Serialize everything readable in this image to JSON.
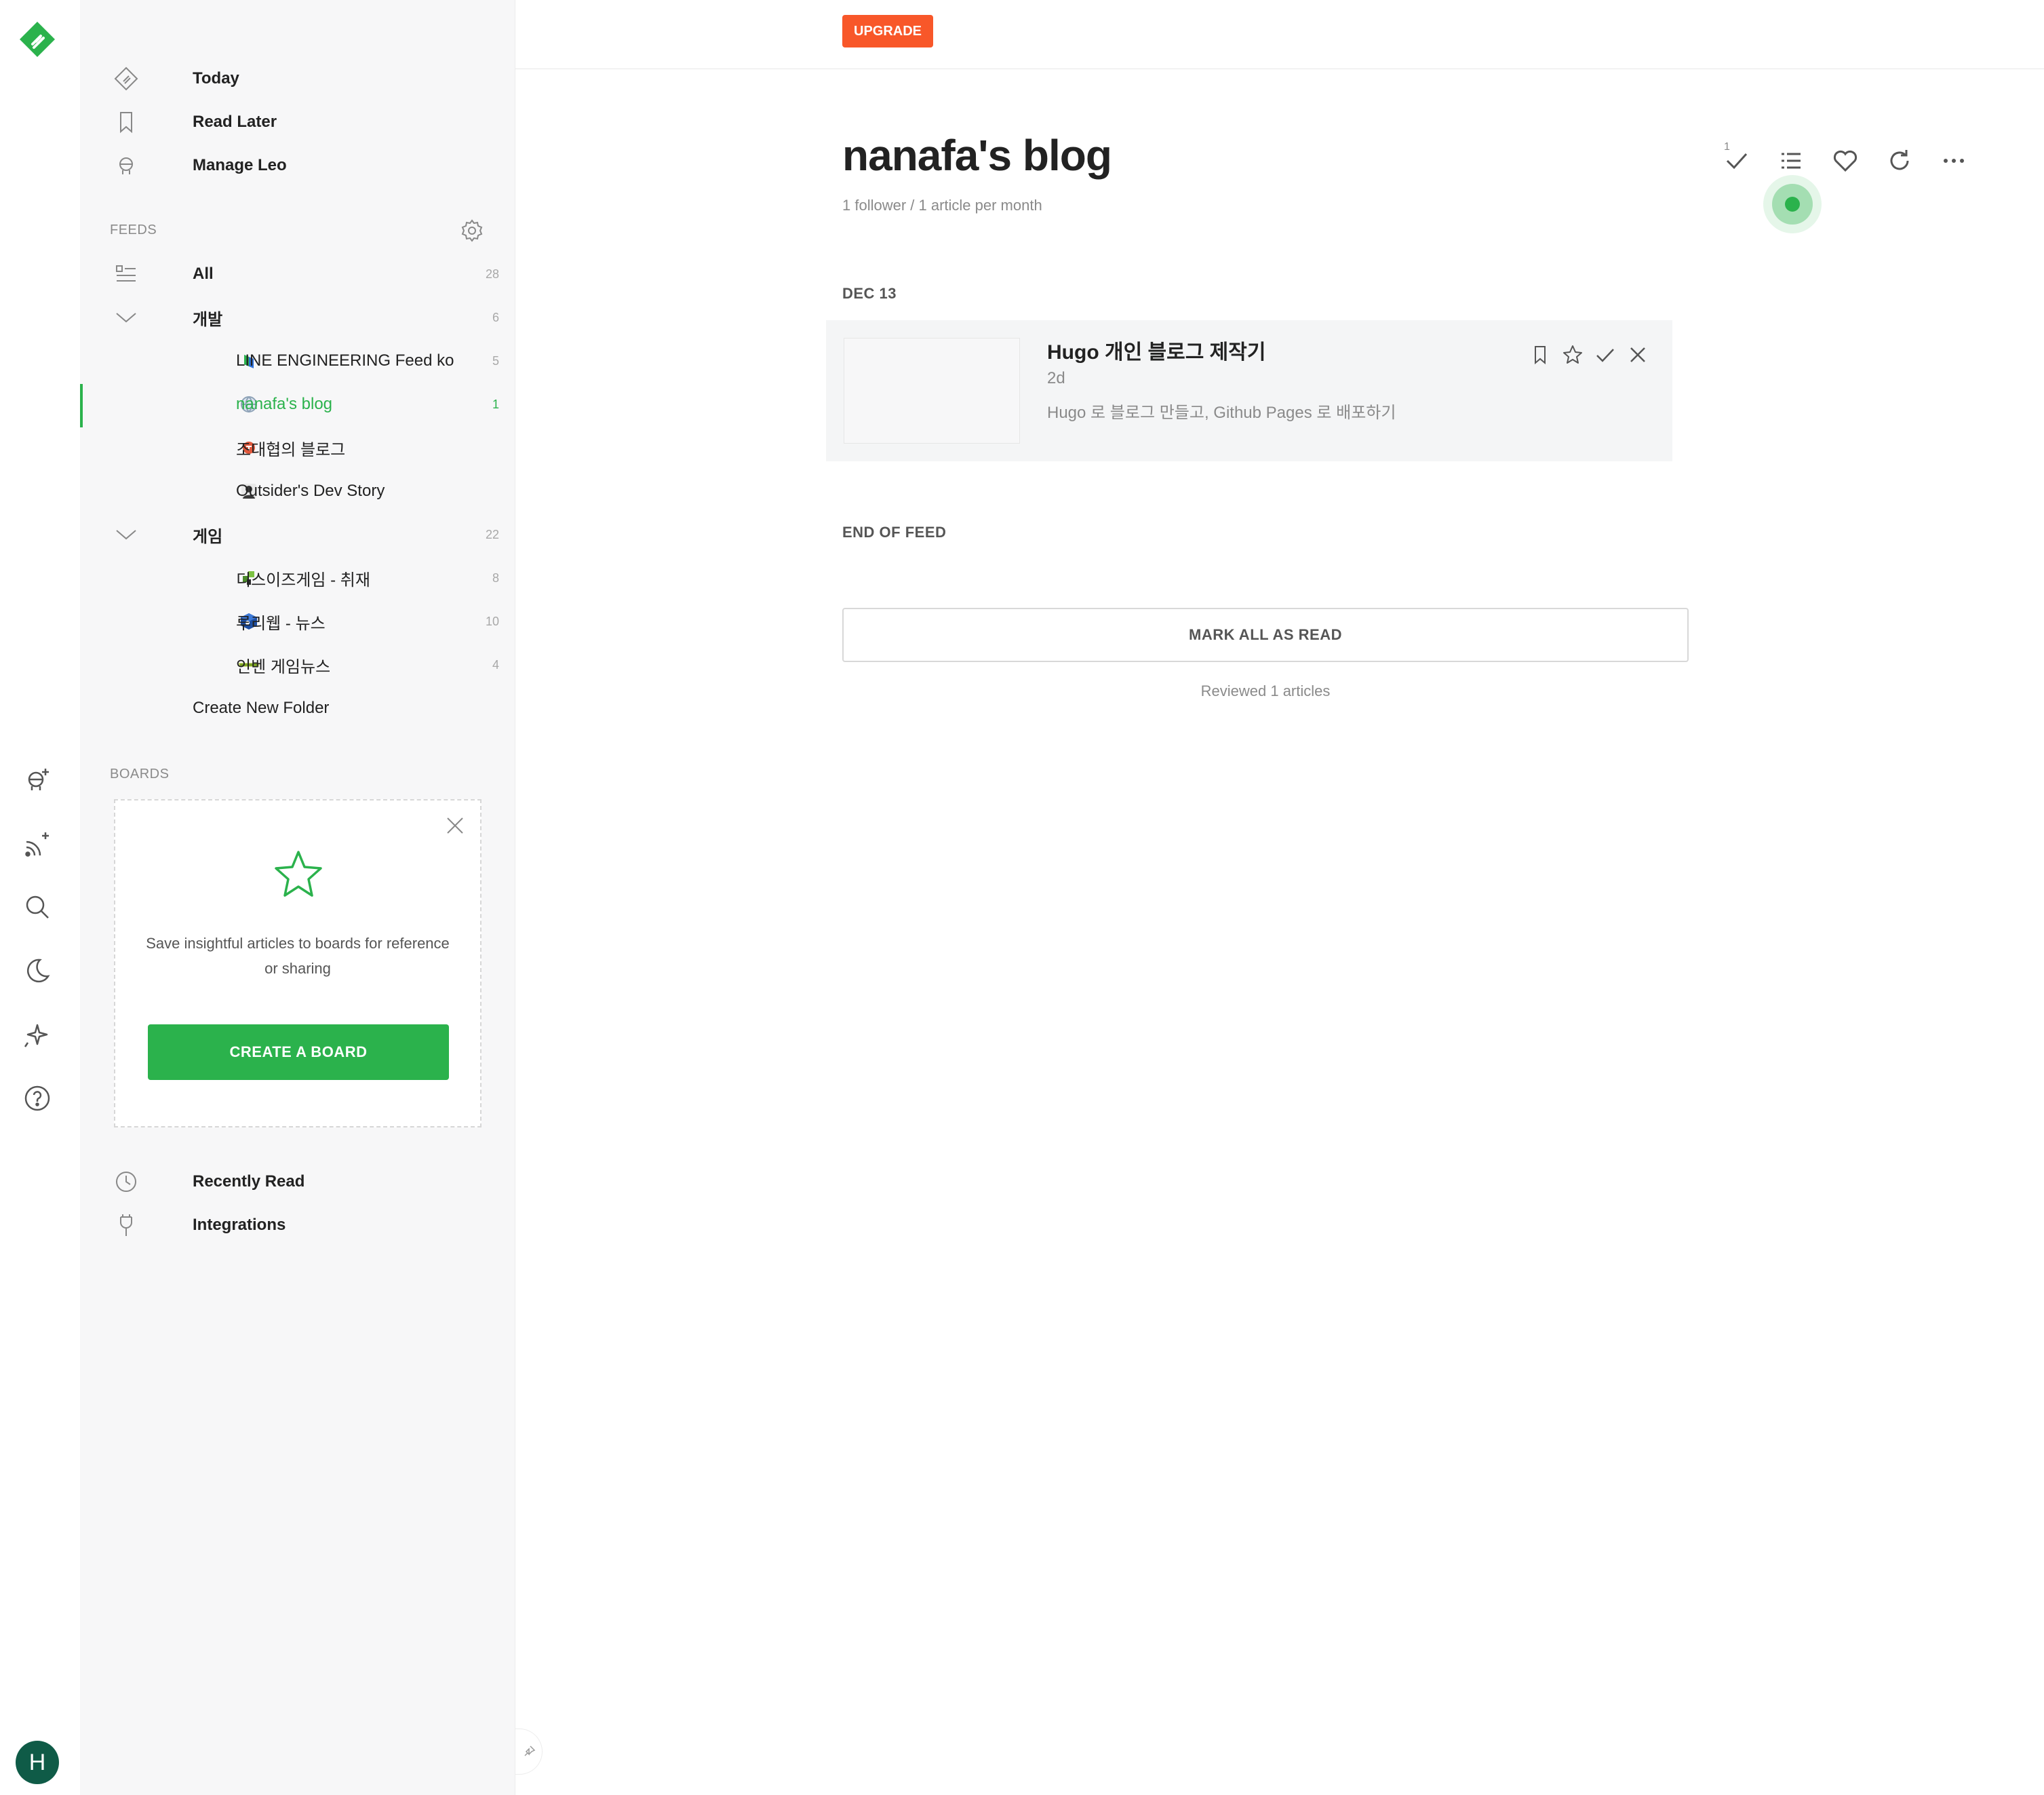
{
  "colors": {
    "accent": "#2bb24c",
    "upgrade": "#f85729",
    "avatar": "#0f5b47"
  },
  "rail": {
    "logo": "feedly-logo",
    "icons": [
      "add-source-leo-icon",
      "add-feed-icon",
      "search-icon",
      "moon-icon",
      "sparkle-icon",
      "help-icon"
    ],
    "avatar_letter": "H"
  },
  "sidebar": {
    "nav": [
      {
        "icon": "today-icon",
        "label": "Today"
      },
      {
        "icon": "bookmark-icon",
        "label": "Read Later"
      },
      {
        "icon": "leo-icon",
        "label": "Manage Leo"
      }
    ],
    "feeds_label": "FEEDS",
    "all": {
      "label": "All",
      "count": "28"
    },
    "folders": [
      {
        "label": "개발",
        "count": "6",
        "feeds": [
          {
            "label": "LINE ENGINEERING Feed ko",
            "count": "5"
          },
          {
            "label": "nanafa's blog",
            "count": "1",
            "active": true
          },
          {
            "label": "조대협의 블로그",
            "count": ""
          },
          {
            "label": "Outsider's Dev Story",
            "count": ""
          }
        ]
      },
      {
        "label": "게임",
        "count": "22",
        "feeds": [
          {
            "label": "디스이즈게임 - 취재",
            "count": "8"
          },
          {
            "label": "루리웹 - 뉴스",
            "count": "10"
          },
          {
            "label": "인벤 게임뉴스",
            "count": "4"
          }
        ]
      }
    ],
    "create_folder": "Create New Folder",
    "boards_label": "BOARDS",
    "board_card": {
      "text": "Save insightful articles to boards for reference or sharing",
      "button": "CREATE A BOARD"
    },
    "bottom": [
      {
        "icon": "clock-icon",
        "label": "Recently Read"
      },
      {
        "icon": "plug-icon",
        "label": "Integrations"
      }
    ]
  },
  "topbar": {
    "upgrade": "UPGRADE"
  },
  "main": {
    "title": "nanafa's blog",
    "meta": "1 follower / 1 article per month",
    "toolbar_count": "1",
    "date_label": "DEC 13",
    "article": {
      "title": "Hugo 개인 블로그 제작기",
      "age": "2d",
      "description": "Hugo 로 블로그 만들고, Github Pages 로 배포하기"
    },
    "end_label": "END OF FEED",
    "mark_all": "MARK ALL AS READ",
    "reviewed": "Reviewed 1 articles"
  }
}
